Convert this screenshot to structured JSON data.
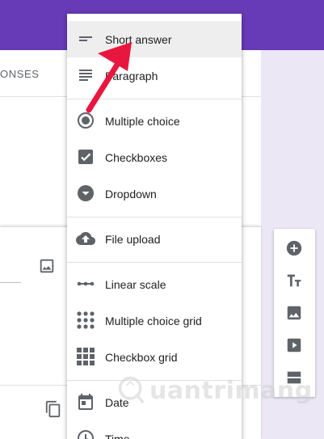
{
  "app": {
    "responses_tab_label": "ONSES",
    "accent_color": "#673ab7",
    "background_color": "#ece7f5"
  },
  "question_menu": {
    "items": [
      {
        "label": "Short answer",
        "icon": "short-text-icon",
        "selected": true
      },
      {
        "label": "Paragraph",
        "icon": "paragraph-icon",
        "selected": false
      },
      {
        "label": "Multiple choice",
        "icon": "radio-button-icon",
        "selected": false
      },
      {
        "label": "Checkboxes",
        "icon": "checkbox-icon",
        "selected": false
      },
      {
        "label": "Dropdown",
        "icon": "dropdown-arrow-icon",
        "selected": false
      },
      {
        "label": "File upload",
        "icon": "cloud-upload-icon",
        "selected": false
      },
      {
        "label": "Linear scale",
        "icon": "linear-scale-icon",
        "selected": false
      },
      {
        "label": "Multiple choice grid",
        "icon": "dot-grid-icon",
        "selected": false
      },
      {
        "label": "Checkbox grid",
        "icon": "square-grid-icon",
        "selected": false
      },
      {
        "label": "Date",
        "icon": "calendar-icon",
        "selected": false
      },
      {
        "label": "Time",
        "icon": "clock-icon",
        "selected": false
      }
    ]
  },
  "toolbar": {
    "buttons": [
      {
        "icon": "add-question-icon"
      },
      {
        "icon": "add-title-icon"
      },
      {
        "icon": "add-image-icon"
      },
      {
        "icon": "add-video-icon"
      },
      {
        "icon": "add-section-icon"
      }
    ]
  },
  "annotation": {
    "arrow_color": "#e8173f"
  },
  "watermark": {
    "text": "uantrimang"
  }
}
